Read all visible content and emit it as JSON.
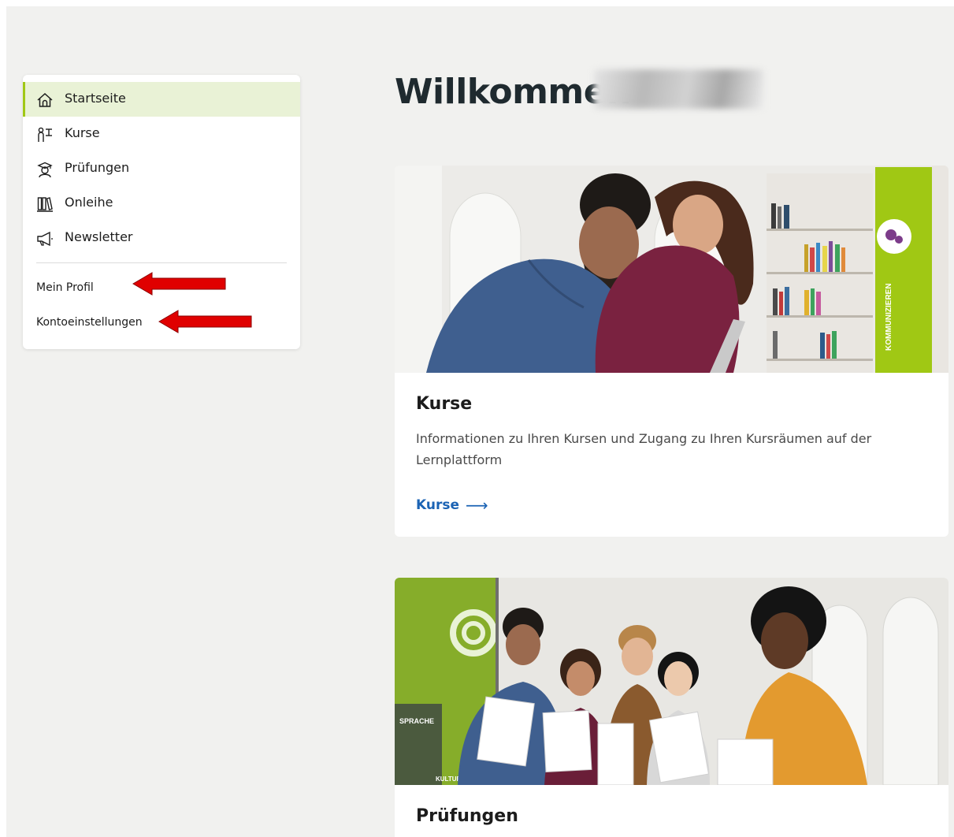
{
  "sidebar": {
    "items": [
      {
        "label": "Startseite",
        "icon": "home-icon",
        "active": true
      },
      {
        "label": "Kurse",
        "icon": "teacher-board-icon",
        "active": false
      },
      {
        "label": "Prüfungen",
        "icon": "graduate-icon",
        "active": false
      },
      {
        "label": "Onleihe",
        "icon": "library-books-icon",
        "active": false
      },
      {
        "label": "Newsletter",
        "icon": "megaphone-icon",
        "active": false
      }
    ],
    "links": [
      {
        "label": "Mein Profil"
      },
      {
        "label": "Kontoeinstellungen"
      }
    ],
    "active_color": "#e9f2d6",
    "active_border": "#a0c814"
  },
  "main": {
    "welcome": "Willkommen",
    "cards": [
      {
        "title": "Kurse",
        "text": "Informationen zu Ihren Kursen und Zugang zu Ihren Kursräumen auf der Lernplattform",
        "link": "Kurse",
        "link_arrow": "⟶",
        "image": "students-library-photo",
        "panel_text": "KOMMUNIZIEREN"
      },
      {
        "title": "Prüfungen",
        "image": "students-certificates-photo",
        "wall_text_1": "SPRACHE",
        "wall_text_2": "KULTUR"
      }
    ]
  },
  "colors": {
    "page_bg": "#f1f1ef",
    "link": "#1b63b4",
    "brand_green": "#a0c814",
    "arrow_red": "#e00000"
  }
}
